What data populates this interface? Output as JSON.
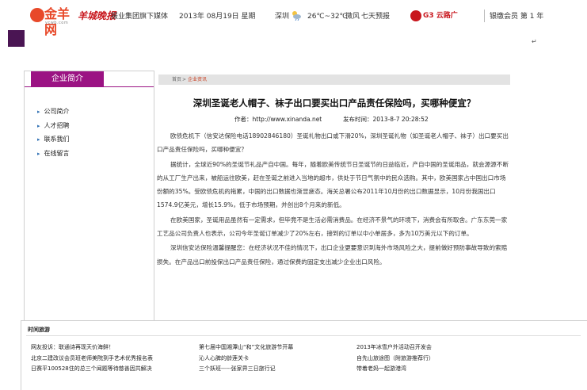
{
  "header": {
    "logo": {
      "text": "金羊网",
      "sub": "ycwb.com"
    },
    "partner": "羊城晚报",
    "slogan": "报业集团旗下媒体",
    "date": "2013年 08月19日 星期",
    "city": "深圳",
    "temperature": "26℃~32℃",
    "wind": "微风",
    "forecast_link": "七天预报",
    "sponsor": "G3 云路广",
    "member": "银缴会员 第 1 年"
  },
  "sidebar": {
    "heading": "企业简介",
    "items": [
      {
        "label": "公司简介"
      },
      {
        "label": "人才招聘"
      },
      {
        "label": "联系我们"
      },
      {
        "label": "在线留言"
      }
    ]
  },
  "breadcrumb": {
    "home": "首页",
    "separator": ">",
    "current": "企业资讯"
  },
  "article": {
    "title": "深圳圣诞老人帽子、袜子出口要买出口产品责任保险吗，买哪种便宜？",
    "author": "作者：http://www.xinanda.net",
    "published": "发布时间：2013-8-7 20:28:52",
    "paragraphs": [
      "欧债危机下（信安达保险电话18902846180）圣诞礼物出口或下滑20%，深圳圣诞礼物（如圣诞老人帽子、袜子）出口要买出口产品责任保险吗，买哪种便宜？",
      "据统计，全球近90%的圣诞节礼品产自中国。每年，随着欧美传统节日圣诞节的日益临近，产自中国的圣诞用品，就会源源不断的从工厂生产出来，被船运往欧美，赶在圣诞之前进入当地的超市，供处于节日气氛中的民众选购。其中，欧美国家占中国出口市场份额的35%。受欧债危机的拖累，中国的出口数据也渐显疲态。海关总署公布2011年10月份的出口数据显示，10月份我国出口1574.9亿美元，增长15.9%，低于市场预期，并创出8个月来的新低。",
      "在欧美国家，圣诞用品虽然有一定需求，但毕竟不是生活必需消费品。在经济不景气的环境下，消费会有所取舍。广东东莞一家工艺品公司负责人也表示，公司今年圣诞订单减少了20%左右，接到的订单以中小单居多，多为10万美元以下的订单。",
      "深圳信安达保险温馨提醒您：在经济状况不佳的情况下，出口企业更要意识到海外市场风险之大，提前做好预防事故导致的索赔损失。在产品出口前投保出口产品责任保险，通过保费的固定支出减少企业出口风险。"
    ]
  },
  "news": {
    "heading": "时间旅游",
    "columns": [
      [
        "网友投诉：联通诗再现天价海鲜！",
        "北京二建改议会员班老师美院到手艺术优秀报名表",
        "日赛平100528住的总三个闻题等待慈善因共解决"
      ],
      [
        "第七届中国湘潭山“和”文化旅游节开幕",
        "沁人心脾的龄莲关卡",
        "三个妖班-----张家界三日旅行记"
      ],
      [
        "2013年冰雪户外活动召开发会",
        "自先山旅途图（附旅游推荐行）",
        "带着老妈一起游港湾"
      ]
    ]
  }
}
